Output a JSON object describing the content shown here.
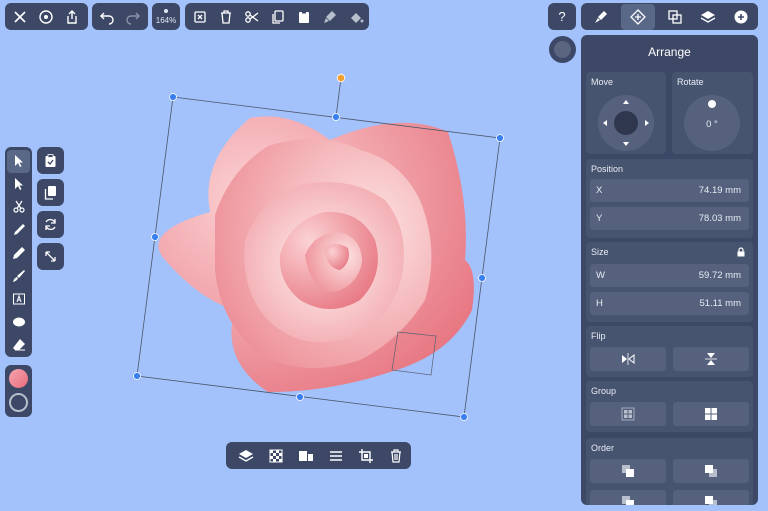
{
  "toolbar": {
    "zoom": "164%"
  },
  "panel": {
    "title": "Arrange",
    "move_label": "Move",
    "rotate_label": "Rotate",
    "rotate_value": "0 °",
    "position_label": "Position",
    "x_label": "X",
    "x_value": "74.19 mm",
    "y_label": "Y",
    "y_value": "78.03 mm",
    "size_label": "Size",
    "w_label": "W",
    "w_value": "59.72 mm",
    "h_label": "H",
    "h_value": "51.11 mm",
    "flip_label": "Flip",
    "group_label": "Group",
    "order_label": "Order"
  },
  "top_right": {
    "help_label": "?"
  },
  "colors": {
    "ui_dark": "#3c4866",
    "canvas": "#a3c1fb",
    "handle": "#3a7ff0",
    "rotate_handle": "#f0a030",
    "fill_start": "#f5a5b0",
    "fill_end": "#e86c7a"
  },
  "icons": {
    "left_toolbar": [
      "close-icon",
      "settings-icon",
      "share-icon"
    ],
    "history": [
      "undo-icon",
      "redo-icon"
    ],
    "edit": [
      "delete-selection-icon",
      "trash-icon",
      "scissors-icon",
      "copy-icon",
      "paste-icon",
      "paint-brush-icon",
      "fill-bucket-icon"
    ],
    "tools": [
      "select-arrow-icon",
      "node-arrow-icon",
      "knife-icon",
      "pen-icon",
      "pencil-icon",
      "brush-icon",
      "text-icon",
      "ellipse-icon",
      "eraser-icon"
    ],
    "bottom": [
      "layers-icon",
      "checker-icon",
      "align-icon",
      "distribute-icon",
      "crop-icon",
      "trash-icon"
    ]
  }
}
